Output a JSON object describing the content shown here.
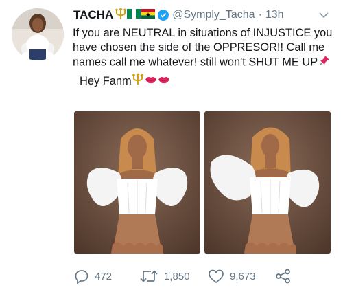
{
  "tweet": {
    "display_name": "TACHA",
    "name_emojis": [
      "trident-emoji",
      "nigeria-flag-emoji",
      "ghana-flag-emoji"
    ],
    "handle": "@Symply_Tacha",
    "separator": "·",
    "time": "13h",
    "text_main": "If you are NEUTRAL in situations of INJUSTICE you have chosen the side of the OPPRESOR!! Call me names call me whatever! still won't SHUT ME UP",
    "text_main_emoji": "pushpin-emoji",
    "text_second": "Hey Fanm",
    "text_second_emojis": [
      "trident-emoji",
      "kiss-lips-emoji",
      "kiss-lips-emoji"
    ]
  },
  "actions": {
    "replies": "472",
    "retweets": "1,850",
    "likes": "9,673"
  },
  "colors": {
    "text_primary": "#14171a",
    "text_secondary": "#657786",
    "verified_blue": "#1da1f2",
    "trident_gold": "#d4a017"
  }
}
